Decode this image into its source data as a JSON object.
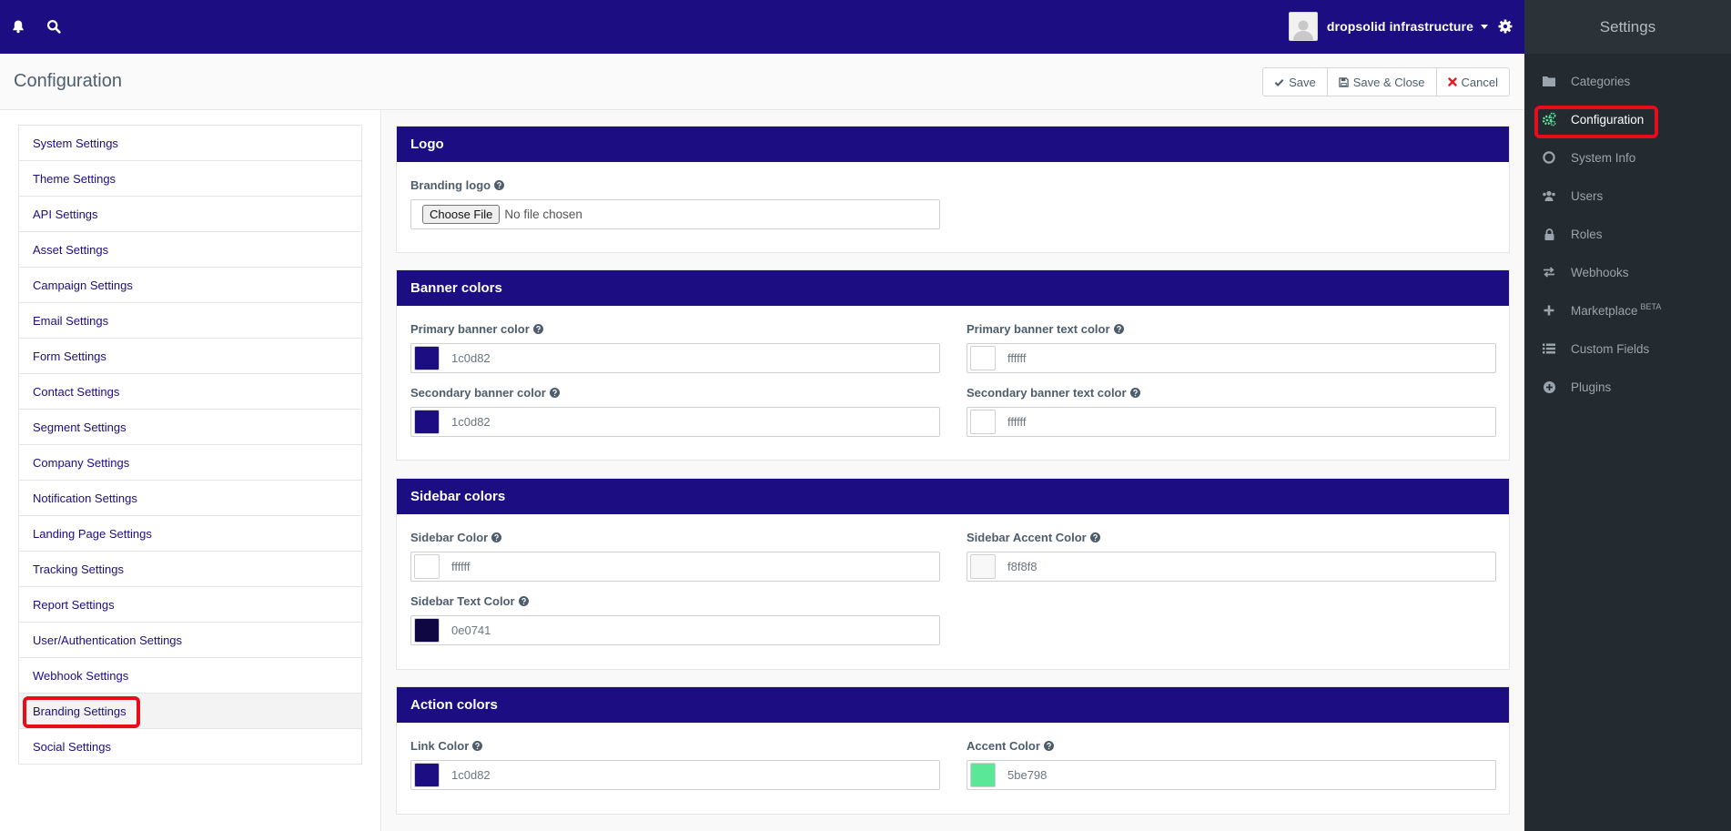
{
  "topbar": {
    "user_name": "dropsolid infrastructure"
  },
  "header": {
    "title": "Configuration",
    "save_label": "Save",
    "save_close_label": "Save & Close",
    "cancel_label": "Cancel"
  },
  "settings_nav": {
    "items": [
      {
        "label": "System Settings"
      },
      {
        "label": "Theme Settings"
      },
      {
        "label": "API Settings"
      },
      {
        "label": "Asset Settings"
      },
      {
        "label": "Campaign Settings"
      },
      {
        "label": "Email Settings"
      },
      {
        "label": "Form Settings"
      },
      {
        "label": "Contact Settings"
      },
      {
        "label": "Segment Settings"
      },
      {
        "label": "Company Settings"
      },
      {
        "label": "Notification Settings"
      },
      {
        "label": "Landing Page Settings"
      },
      {
        "label": "Tracking Settings"
      },
      {
        "label": "Report Settings"
      },
      {
        "label": "User/Authentication Settings"
      },
      {
        "label": "Webhook Settings"
      },
      {
        "label": "Branding Settings"
      },
      {
        "label": "Social Settings"
      }
    ],
    "active": "Branding Settings"
  },
  "right_sidebar": {
    "title": "Settings",
    "items": [
      {
        "label": "Categories",
        "icon": "folder-icon"
      },
      {
        "label": "Configuration",
        "icon": "cogs-icon"
      },
      {
        "label": "System Info",
        "icon": "life-ring-icon"
      },
      {
        "label": "Users",
        "icon": "users-icon"
      },
      {
        "label": "Roles",
        "icon": "lock-icon"
      },
      {
        "label": "Webhooks",
        "icon": "exchange-icon"
      },
      {
        "label": "Marketplace",
        "icon": "plus-icon",
        "badge": "BETA"
      },
      {
        "label": "Custom Fields",
        "icon": "list-icon"
      },
      {
        "label": "Plugins",
        "icon": "plus-circle-icon"
      }
    ],
    "active": "Configuration"
  },
  "logo": {
    "title": "Logo",
    "branding_logo_label": "Branding logo",
    "choose_file_label": "Choose File",
    "no_file_text": "No file chosen"
  },
  "banner_colors": {
    "title": "Banner colors",
    "primary": {
      "label": "Primary banner color",
      "value": "1c0d82",
      "swatch": "#1c0d82"
    },
    "primary_text": {
      "label": "Primary banner text color",
      "value": "ffffff",
      "swatch": "#ffffff"
    },
    "secondary": {
      "label": "Secondary banner color",
      "value": "1c0d82",
      "swatch": "#1c0d82"
    },
    "secondary_text": {
      "label": "Secondary banner text color",
      "value": "ffffff",
      "swatch": "#ffffff"
    }
  },
  "sidebar_colors": {
    "title": "Sidebar colors",
    "sidebar": {
      "label": "Sidebar Color",
      "value": "ffffff",
      "swatch": "#ffffff"
    },
    "accent": {
      "label": "Sidebar Accent Color",
      "value": "f8f8f8",
      "swatch": "#f8f8f8"
    },
    "text": {
      "label": "Sidebar Text Color",
      "value": "0e0741",
      "swatch": "#0e0741"
    }
  },
  "action_colors": {
    "title": "Action colors",
    "link": {
      "label": "Link Color",
      "value": "1c0d82",
      "swatch": "#1c0d82"
    },
    "accent": {
      "label": "Accent Color",
      "value": "5be798",
      "swatch": "#5be798"
    }
  },
  "colors": {
    "brand": "#1c0d82",
    "highlight": "#e50e1a",
    "sidebar_bg": "#232a30",
    "config_icon": "#5be798"
  }
}
